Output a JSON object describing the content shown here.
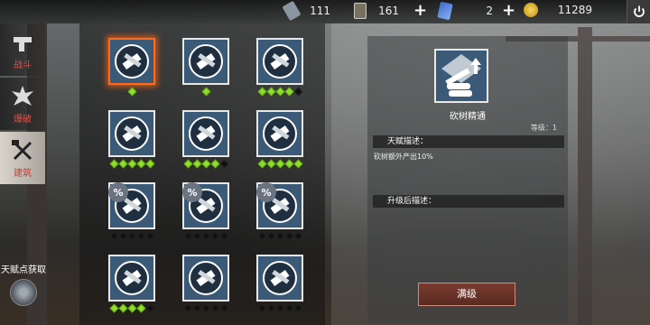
{
  "resources": [
    {
      "name": "phone-resource",
      "icon": "phone-icon",
      "value": "111",
      "color": "#8a95a0"
    },
    {
      "name": "card-resource",
      "icon": "card-icon",
      "value": "161",
      "color": "#7a7060"
    },
    {
      "name": "ticket-resource",
      "icon": "ticket-icon",
      "value": "2",
      "color": "#3a6ad0"
    },
    {
      "name": "coin-resource",
      "icon": "coin-icon",
      "value": "11289",
      "color": "#e0b020"
    }
  ],
  "tabs": [
    {
      "label": "战斗",
      "icon": "combat-icon",
      "active": false
    },
    {
      "label": "爆破",
      "icon": "explosion-icon",
      "active": false
    },
    {
      "label": "建筑",
      "icon": "building-icon",
      "active": true
    }
  ],
  "talent_point_label": "天赋点获取",
  "talents": [
    {
      "icon": "wood-chopping-icon",
      "dots": [
        1
      ],
      "selected": true,
      "pct": false
    },
    {
      "icon": "ore-upgrade-icon",
      "dots": [
        1
      ],
      "selected": false,
      "pct": false
    },
    {
      "icon": "crossed-tools-icon",
      "dots": [
        1,
        1,
        1,
        1,
        0
      ],
      "selected": false,
      "pct": false
    },
    {
      "icon": "medkit-icon",
      "dots": [
        1,
        1,
        1,
        1,
        1
      ],
      "selected": false,
      "pct": false
    },
    {
      "icon": "chainsaw-icon",
      "dots": [
        1,
        1,
        1,
        1,
        0
      ],
      "selected": false,
      "pct": false
    },
    {
      "icon": "wrench-flask-gear-icon",
      "dots": [
        1,
        1,
        1,
        1,
        1
      ],
      "selected": false,
      "pct": false
    },
    {
      "icon": "flask-gear-icon",
      "dots": [
        0,
        0,
        0,
        0,
        0
      ],
      "selected": false,
      "pct": true
    },
    {
      "icon": "document-icon",
      "dots": [
        0,
        0,
        0,
        0,
        0
      ],
      "selected": false,
      "pct": true
    },
    {
      "icon": "wrench-screwdriver-icon",
      "dots": [
        0,
        0,
        0,
        0,
        0
      ],
      "selected": false,
      "pct": true
    },
    {
      "icon": "skull-mask-icon",
      "dots": [
        1,
        1,
        1,
        1,
        0
      ],
      "selected": false,
      "pct": false
    },
    {
      "icon": "drill-icon",
      "dots": [
        0,
        0,
        0,
        0,
        0
      ],
      "selected": false,
      "pct": false
    },
    {
      "icon": "device-icon",
      "dots": [
        0,
        0,
        0,
        0,
        0
      ],
      "selected": false,
      "pct": false
    }
  ],
  "pct_symbol": "%",
  "detail": {
    "name": "砍树精通",
    "level": "等级：1",
    "desc_header": "天赋描述：",
    "desc_text": "砍树额外产出10%",
    "upgrade_header": "升级后描述：",
    "max_button": "满级"
  }
}
